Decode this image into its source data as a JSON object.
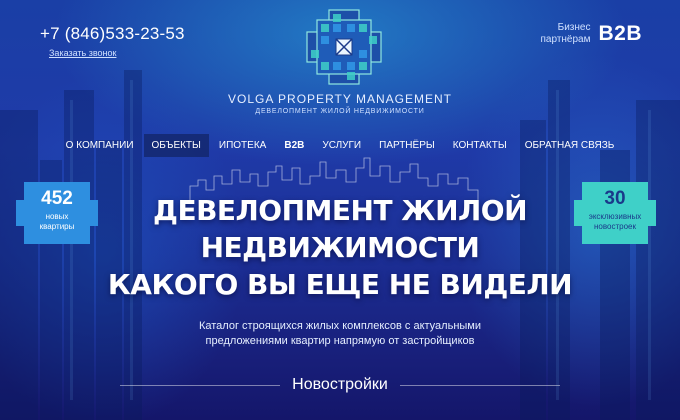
{
  "header": {
    "phone": "+7 (846)533-23-53",
    "callback_link": "Заказать звонок",
    "b2b_caption_line1": "Бизнес",
    "b2b_caption_line2": "партнёрам",
    "b2b_label": "B2B"
  },
  "brand": {
    "name": "VOLGA PROPERTY MANAGEMENT",
    "tagline": "ДЕВЕЛОПМЕНТ ЖИЛОЙ НЕДВИЖИМОСТИ"
  },
  "nav": {
    "items": [
      {
        "label": "О КОМПАНИИ"
      },
      {
        "label": "ОБЪЕКТЫ"
      },
      {
        "label": "ИПОТЕКА"
      },
      {
        "label": "B2B"
      },
      {
        "label": "УСЛУГИ"
      },
      {
        "label": "ПАРТНЁРЫ"
      },
      {
        "label": "КОНТАКТЫ"
      },
      {
        "label": "ОБРАТНАЯ СВЯЗЬ"
      }
    ],
    "active_index": 1
  },
  "stats": {
    "left": {
      "value": "452",
      "label_line1": "новых",
      "label_line2": "квартиры",
      "color": "#2e8fe0"
    },
    "right": {
      "value": "30",
      "label_line1": "эксклюзивных",
      "label_line2": "новостроек",
      "color": "#3fd0c8"
    }
  },
  "hero": {
    "line1": "ДЕВЕЛОПМЕНТ ЖИЛОЙ",
    "line2": "НЕДВИЖИМОСТИ",
    "line3": "КАКОГО ВЫ ЕЩЕ НЕ ВИДЕЛИ",
    "subtitle_line1": "Каталог строящихся жилых комплексов с актуальными",
    "subtitle_line2": "предложениями квартир напрямую от застройщиков"
  },
  "section": {
    "title": "Новостройки"
  },
  "colors": {
    "accent": "#2e8fe0",
    "teal": "#3fd0c8",
    "nav_active_bg": "#142c6e",
    "background_top": "#1a3fa6",
    "background_bottom": "#14166a"
  }
}
